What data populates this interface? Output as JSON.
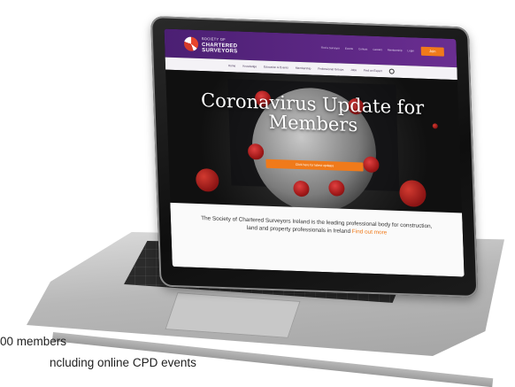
{
  "site": {
    "logo_line1": "SOCIETY OF",
    "logo_line2": "CHARTERED",
    "logo_line3": "SURVEYORS",
    "top_links": [
      "Find a Surveyor",
      "Events",
      "Contact",
      "Careers",
      "Membership",
      "Login"
    ],
    "join_label": "Join",
    "nav": [
      "Home",
      "Knowledge",
      "Education & Events",
      "Membership",
      "Professional Groups",
      "Jobs",
      "Find an Expert"
    ],
    "hero_title": "Coronavirus Update for Members",
    "hero_button": "Click here for latest updates",
    "about_text": "The Society of Chartered Surveyors Ireland is the leading professional body for construction, land and property professionals in Ireland",
    "about_link": "Find out more"
  },
  "captions": {
    "line1": "00 members",
    "line2": "ncluding online CPD events"
  }
}
